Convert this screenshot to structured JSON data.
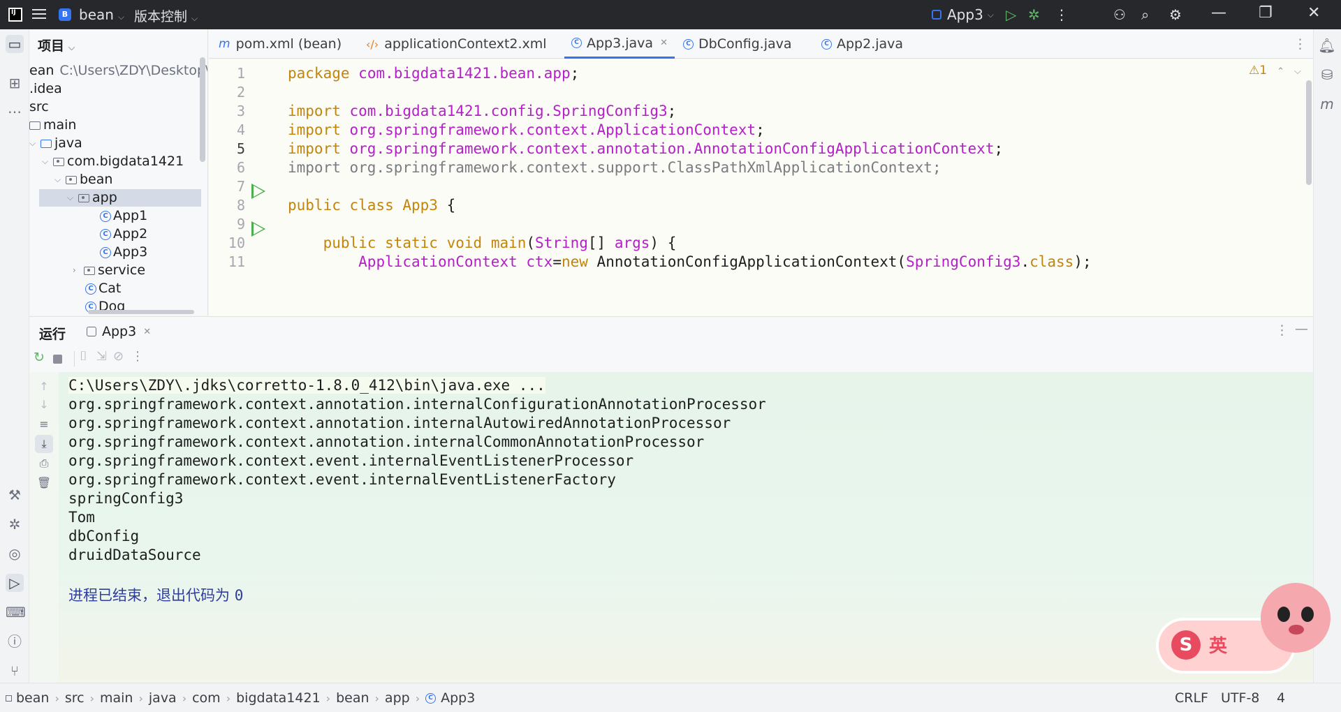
{
  "titlebar": {
    "project_badge": "B",
    "project_name": "bean",
    "vcs_label": "版本控制",
    "run_config": "App3"
  },
  "project_panel": {
    "header": "项目",
    "root_prefix": "ean",
    "root_path": "C:\\Users\\ZDY\\Desktop\\",
    "tree": [
      {
        "label": ".idea"
      },
      {
        "label": "src"
      },
      {
        "label": "main"
      },
      {
        "label": "java"
      },
      {
        "label": "com.bigdata1421"
      },
      {
        "label": "bean"
      },
      {
        "label": "app"
      },
      {
        "label": "App1"
      },
      {
        "label": "App2"
      },
      {
        "label": "App3"
      },
      {
        "label": "service"
      },
      {
        "label": "Cat"
      },
      {
        "label": "Dog"
      }
    ]
  },
  "editor_tabs": [
    {
      "label": "pom.xml (bean)",
      "icon": "maven-icon"
    },
    {
      "label": "applicationContext2.xml",
      "icon": "xml-icon"
    },
    {
      "label": "App3.java",
      "icon": "class-icon",
      "active": true
    },
    {
      "label": "DbConfig.java",
      "icon": "class-icon"
    },
    {
      "label": "App2.java",
      "icon": "class-icon"
    }
  ],
  "editor": {
    "warning_count": "1",
    "line_numbers": [
      "1",
      "2",
      "3",
      "4",
      "5",
      "6",
      "7",
      "8",
      "9",
      "10",
      "11"
    ],
    "current_line": "5"
  },
  "run_panel": {
    "title": "运行",
    "tab": "App3"
  },
  "console": {
    "lines": [
      "C:\\Users\\ZDY\\.jdks\\corretto-1.8.0_412\\bin\\java.exe ...",
      "org.springframework.context.annotation.internalConfigurationAnnotationProcessor",
      "org.springframework.context.annotation.internalAutowiredAnnotationProcessor",
      "org.springframework.context.annotation.internalCommonAnnotationProcessor",
      "org.springframework.context.event.internalEventListenerProcessor",
      "org.springframework.context.event.internalEventListenerFactory",
      "springConfig3",
      "Tom",
      "dbConfig",
      "druidDataSource"
    ],
    "exit_text": "进程已结束，退出代码为 ",
    "exit_code": "0"
  },
  "statusbar": {
    "breadcrumbs": [
      "bean",
      "src",
      "main",
      "java",
      "com",
      "bigdata1421",
      "bean",
      "app",
      "App3"
    ],
    "line_ending": "CRLF",
    "encoding": "UTF-8",
    "indent": "4"
  },
  "mascot": {
    "badge_letter": "S",
    "badge_text": "英"
  }
}
